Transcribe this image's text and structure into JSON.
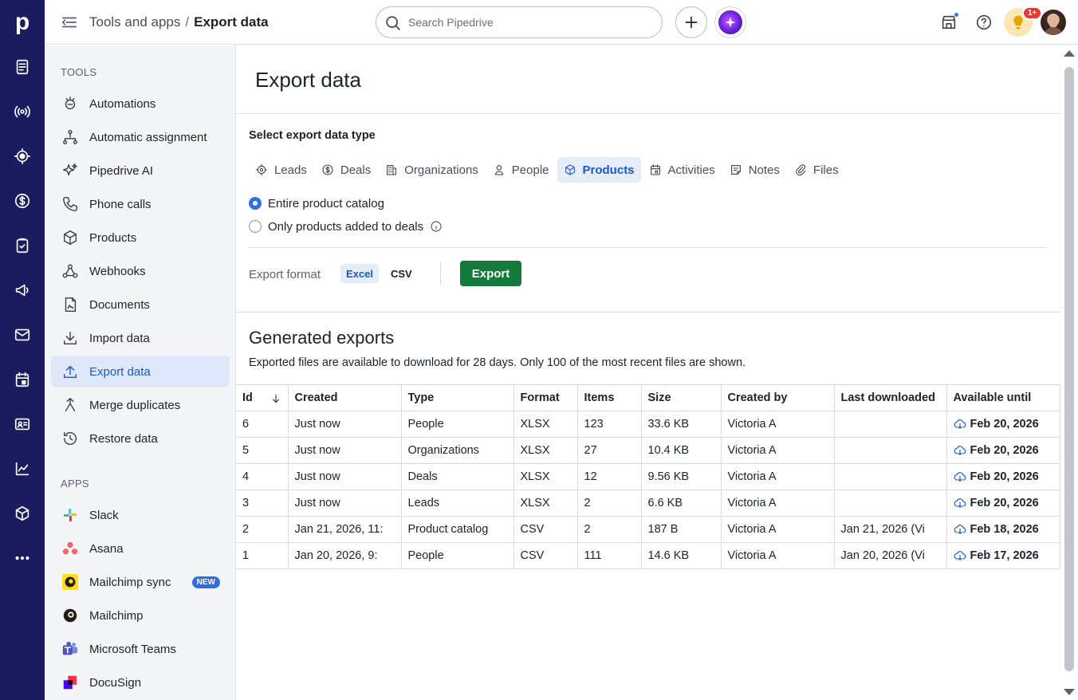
{
  "app": {
    "logo_letter": "p"
  },
  "rail": [
    {
      "icon": "leads-inbox-icon"
    },
    {
      "icon": "campaigns-broadcast-icon"
    },
    {
      "icon": "leads-target-icon"
    },
    {
      "icon": "deals-dollar-icon"
    },
    {
      "icon": "activities-clipboard-icon"
    },
    {
      "icon": "campaigns-megaphone-icon"
    },
    {
      "icon": "mail-icon"
    },
    {
      "icon": "calendar-icon"
    },
    {
      "icon": "contacts-card-icon"
    },
    {
      "icon": "insights-chart-icon"
    },
    {
      "icon": "products-box-icon"
    },
    {
      "icon": "more-icon"
    }
  ],
  "header": {
    "breadcrumb_parent": "Tools and apps",
    "breadcrumb_sep": "/",
    "breadcrumb_current": "Export data",
    "search_placeholder": "Search Pipedrive",
    "notification_count": "1+"
  },
  "sidebar": {
    "tools_title": "TOOLS",
    "tools": [
      {
        "label": "Automations",
        "icon": "automations-icon"
      },
      {
        "label": "Automatic assignment",
        "icon": "automatic-assignment-icon"
      },
      {
        "label": "Pipedrive AI",
        "icon": "sparkle-icon"
      },
      {
        "label": "Phone calls",
        "icon": "phone-icon"
      },
      {
        "label": "Products",
        "icon": "box-icon"
      },
      {
        "label": "Webhooks",
        "icon": "webhooks-icon"
      },
      {
        "label": "Documents",
        "icon": "document-icon"
      },
      {
        "label": "Import data",
        "icon": "download-icon"
      },
      {
        "label": "Export data",
        "icon": "upload-icon",
        "active": true
      },
      {
        "label": "Merge duplicates",
        "icon": "merge-icon"
      },
      {
        "label": "Restore data",
        "icon": "restore-icon"
      }
    ],
    "apps_title": "APPS",
    "apps": [
      {
        "label": "Slack",
        "icon": "slack-logo-icon"
      },
      {
        "label": "Asana",
        "icon": "asana-logo-icon"
      },
      {
        "label": "Mailchimp sync",
        "icon": "mailchimp-logo-icon",
        "badge": "NEW"
      },
      {
        "label": "Mailchimp",
        "icon": "mailchimp-logo-icon"
      },
      {
        "label": "Microsoft Teams",
        "icon": "teams-logo-icon"
      },
      {
        "label": "DocuSign",
        "icon": "docusign-logo-icon"
      }
    ]
  },
  "main": {
    "title": "Export data",
    "select_label": "Select export data type",
    "tabs": [
      {
        "label": "Leads",
        "icon": "target-icon"
      },
      {
        "label": "Deals",
        "icon": "dollar-icon"
      },
      {
        "label": "Organizations",
        "icon": "building-icon"
      },
      {
        "label": "People",
        "icon": "person-icon"
      },
      {
        "label": "Products",
        "icon": "box-icon",
        "active": true
      },
      {
        "label": "Activities",
        "icon": "calendar-icon"
      },
      {
        "label": "Notes",
        "icon": "note-icon"
      },
      {
        "label": "Files",
        "icon": "paperclip-icon"
      }
    ],
    "options": [
      {
        "label": "Entire product catalog",
        "checked": true
      },
      {
        "label": "Only products added to deals",
        "checked": false
      }
    ],
    "format_label": "Export format",
    "formats": [
      {
        "label": "Excel",
        "selected": true
      },
      {
        "label": "CSV",
        "selected": false
      }
    ],
    "export_label": "Export",
    "generated_title": "Generated exports",
    "generated_desc": "Exported files are available to download for 28 days. Only 100 of the most recent files are shown.",
    "columns": [
      "Id",
      "Created",
      "Type",
      "Format",
      "Items",
      "Size",
      "Created by",
      "Last downloaded",
      "Available until"
    ],
    "rows": [
      [
        "6",
        "Just now",
        "People",
        "XLSX",
        "123",
        "33.6 KB",
        "Victoria A",
        "",
        "Feb 20, 2026"
      ],
      [
        "5",
        "Just now",
        "Organizations",
        "XLSX",
        "27",
        "10.4 KB",
        "Victoria A",
        "",
        "Feb 20, 2026"
      ],
      [
        "4",
        "Just now",
        "Deals",
        "XLSX",
        "12",
        "9.56 KB",
        "Victoria A",
        "",
        "Feb 20, 2026"
      ],
      [
        "3",
        "Just now",
        "Leads",
        "XLSX",
        "2",
        "6.6 KB",
        "Victoria A",
        "",
        "Feb 20, 2026"
      ],
      [
        "2",
        "Jan 21, 2026, 11:",
        "Product catalog",
        "CSV",
        "2",
        "187 B",
        "Victoria A",
        "Jan 21, 2026 (Vi",
        "Feb 18, 2026"
      ],
      [
        "1",
        "Jan 20, 2026, 9:",
        "People",
        "CSV",
        "111",
        "14.6 KB",
        "Victoria A",
        "Jan 20, 2026 (Vi",
        "Feb 17, 2026"
      ]
    ]
  }
}
